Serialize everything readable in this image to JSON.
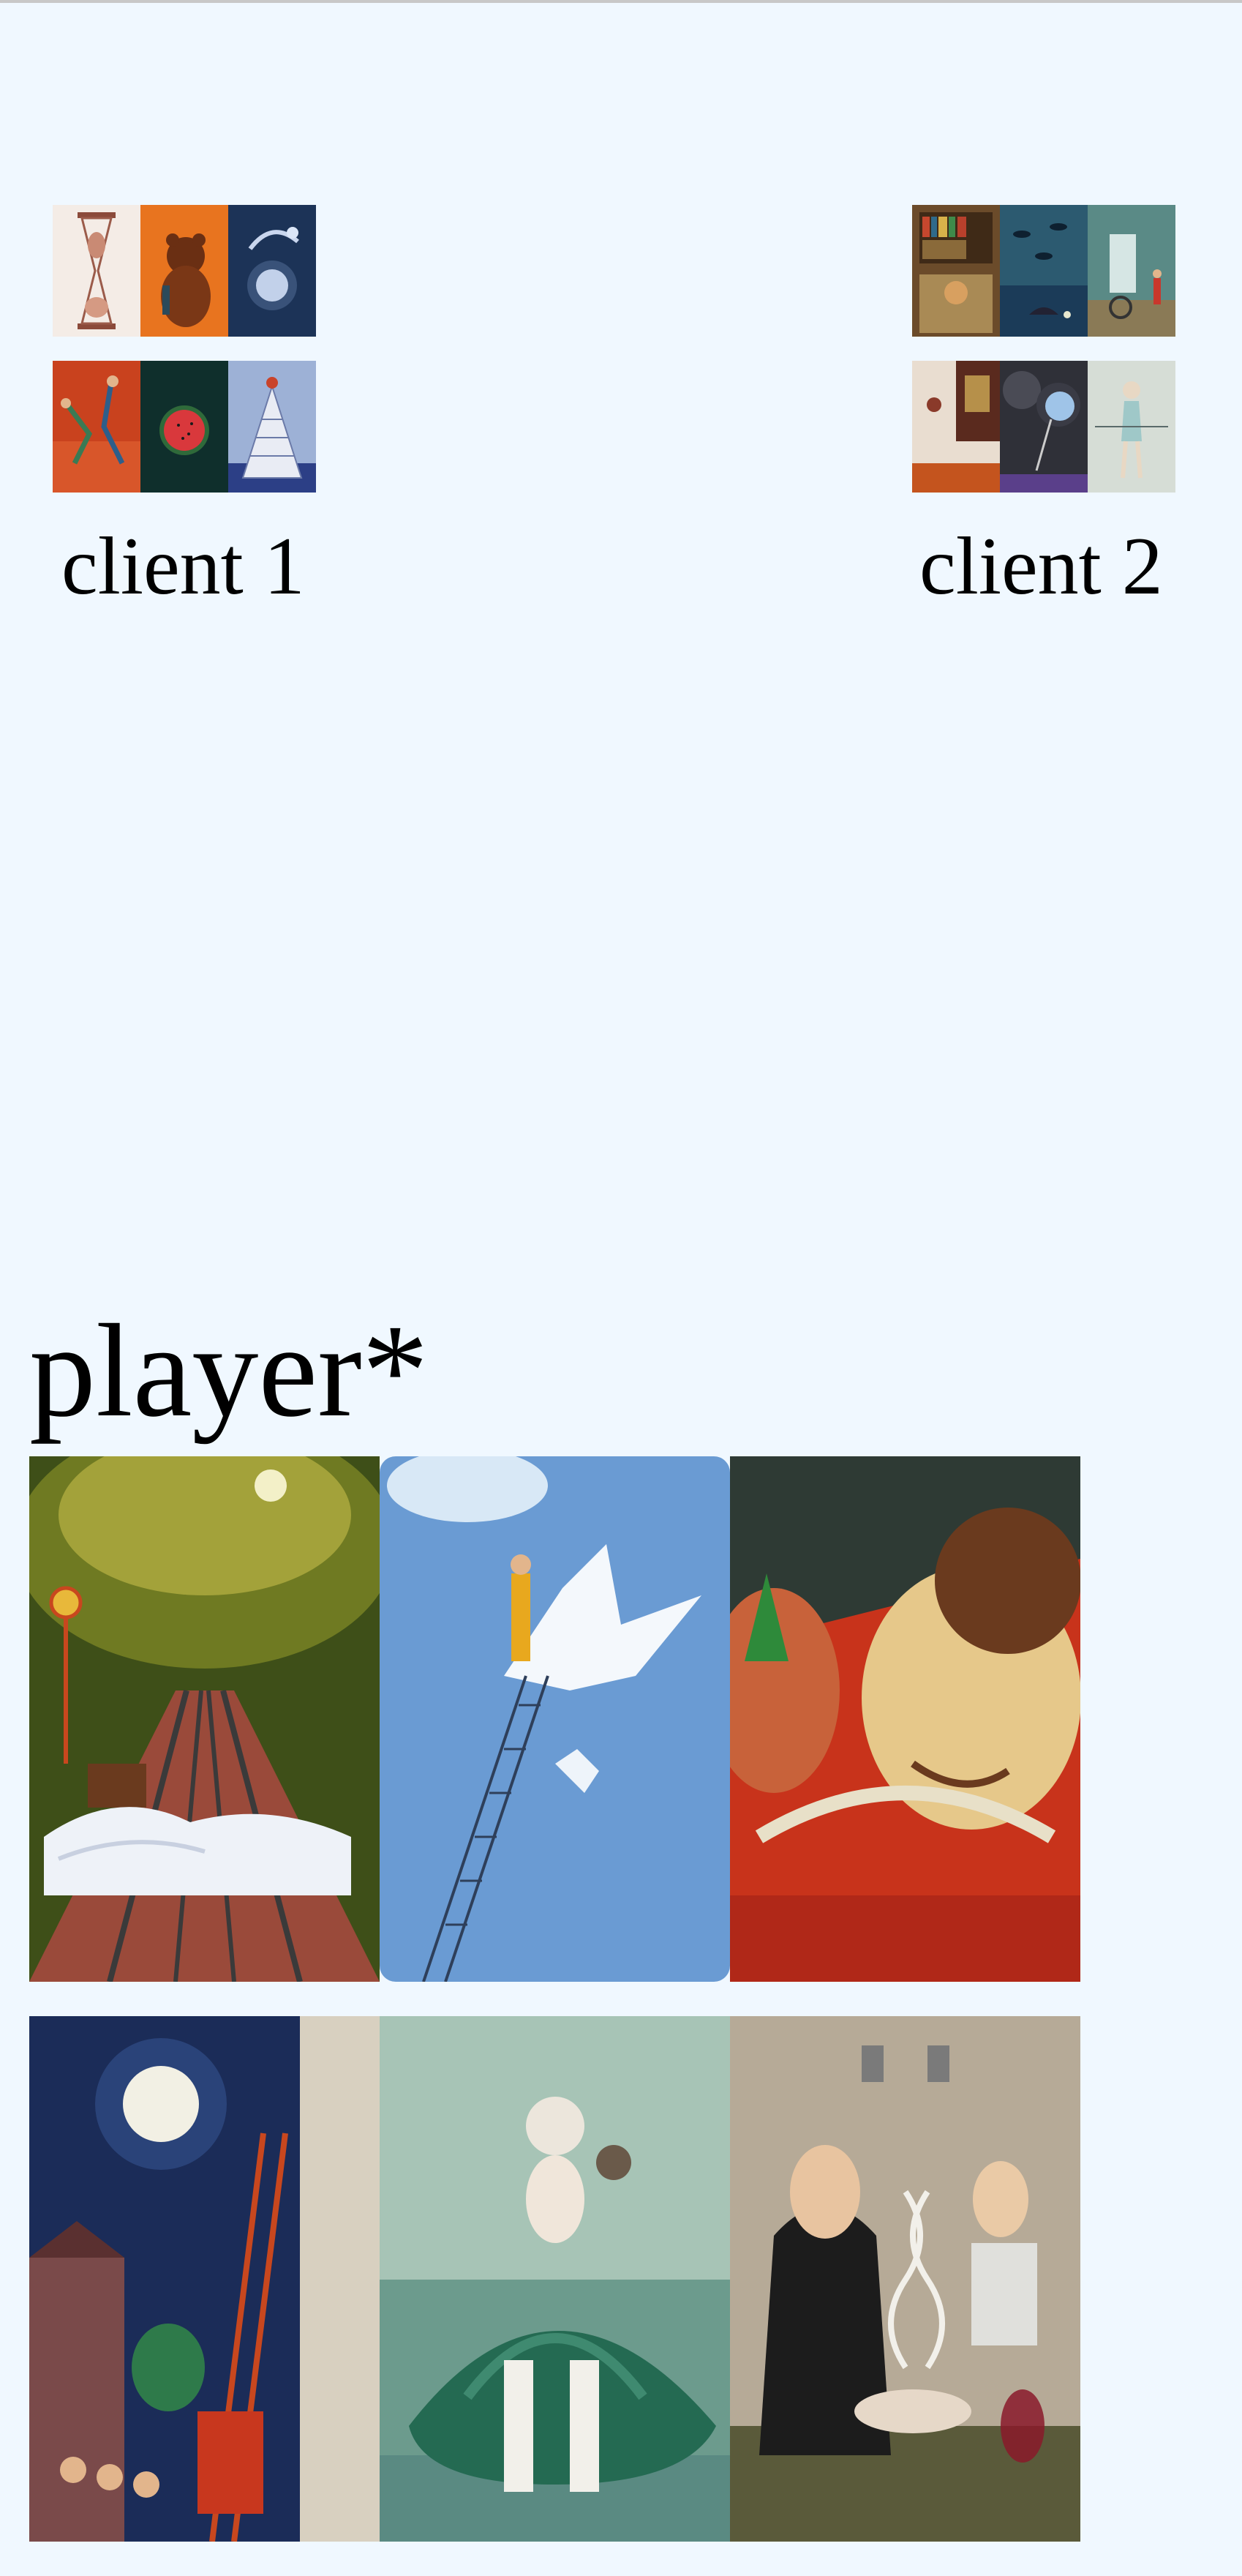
{
  "clients": [
    {
      "label": "client 1",
      "cards": [
        {
          "icon": "hourglass-card",
          "bg": "#f4ece6"
        },
        {
          "icon": "bear-card",
          "bg": "#e8741f"
        },
        {
          "icon": "night-figure-card",
          "bg": "#1c3357"
        },
        {
          "icon": "dancers-card",
          "bg": "#c9421e"
        },
        {
          "icon": "watermelon-card",
          "bg": "#0f2f2c"
        },
        {
          "icon": "tower-card",
          "bg": "#9db1d6"
        }
      ]
    },
    {
      "label": "client 2",
      "cards": [
        {
          "icon": "library-card",
          "bg": "#6b4b2a"
        },
        {
          "icon": "fish-sky-card",
          "bg": "#2c5a70"
        },
        {
          "icon": "doorway-card",
          "bg": "#5a8a86"
        },
        {
          "icon": "collage-card",
          "bg": "#e9ddd0"
        },
        {
          "icon": "storm-card",
          "bg": "#2f3038"
        },
        {
          "icon": "dancer-card",
          "bg": "#d6ddd6"
        }
      ]
    }
  ],
  "player": {
    "label": "player*",
    "cards": [
      {
        "icon": "railway-bed-card",
        "bg": "#3e4f18"
      },
      {
        "icon": "dove-ladder-card",
        "bg": "#6a9bd3"
      },
      {
        "icon": "car-kiss-card",
        "bg": "#c8331b"
      },
      {
        "icon": "moon-serenade-card",
        "bg": "#1b2c58"
      },
      {
        "icon": "green-gown-card",
        "bg": "#6c9b8d"
      },
      {
        "icon": "dna-soup-card",
        "bg": "#b6aa97"
      }
    ]
  }
}
